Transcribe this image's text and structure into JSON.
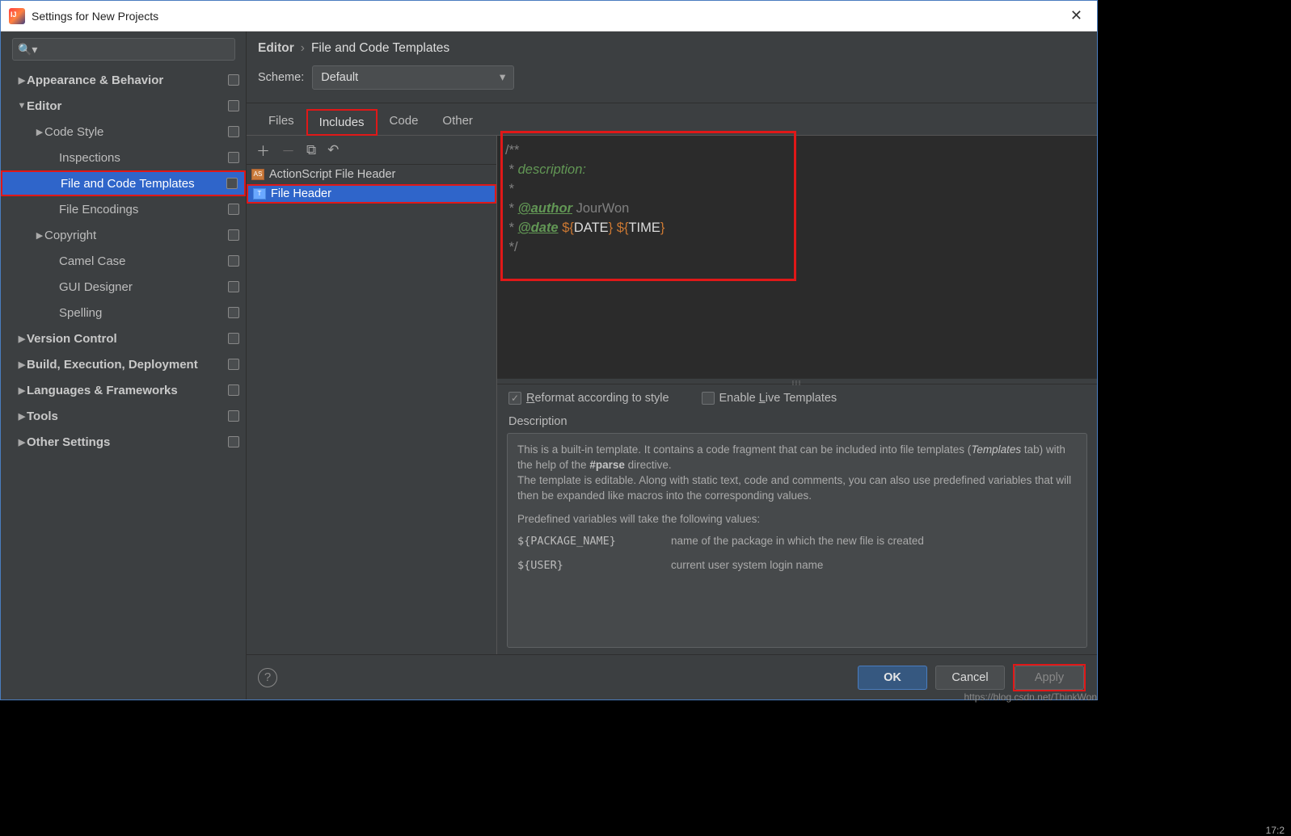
{
  "window": {
    "title": "Settings for New Projects"
  },
  "sidebar": {
    "items": [
      {
        "label": "Appearance & Behavior",
        "indent": 20,
        "chev": "▶",
        "bold": true
      },
      {
        "label": "Editor",
        "indent": 20,
        "chev": "▼",
        "bold": true
      },
      {
        "label": "Code Style",
        "indent": 42,
        "chev": "▶"
      },
      {
        "label": "Inspections",
        "indent": 60
      },
      {
        "label": "File and Code Templates",
        "indent": 60,
        "selected": true
      },
      {
        "label": "File Encodings",
        "indent": 60
      },
      {
        "label": "Copyright",
        "indent": 42,
        "chev": "▶"
      },
      {
        "label": "Camel Case",
        "indent": 60
      },
      {
        "label": "GUI Designer",
        "indent": 60
      },
      {
        "label": "Spelling",
        "indent": 60
      },
      {
        "label": "Version Control",
        "indent": 20,
        "chev": "▶",
        "bold": true
      },
      {
        "label": "Build, Execution, Deployment",
        "indent": 20,
        "chev": "▶",
        "bold": true
      },
      {
        "label": "Languages & Frameworks",
        "indent": 20,
        "chev": "▶",
        "bold": true
      },
      {
        "label": "Tools",
        "indent": 20,
        "chev": "▶",
        "bold": true
      },
      {
        "label": "Other Settings",
        "indent": 20,
        "chev": "▶",
        "bold": true
      }
    ]
  },
  "breadcrumb": {
    "root": "Editor",
    "current": "File and Code Templates"
  },
  "scheme": {
    "label": "Scheme:",
    "value": "Default"
  },
  "tabs": [
    "Files",
    "Includes",
    "Code",
    "Other"
  ],
  "template_list": [
    {
      "label": "ActionScript File Header",
      "icon": "AS"
    },
    {
      "label": "File Header",
      "icon": "T",
      "selected": true
    }
  ],
  "code": {
    "l1": "/**",
    "l2_star": " * ",
    "l2_text": "description:",
    "l3": " *",
    "l4_star": " * ",
    "l4_tag": "@author",
    "l4_val": " JourWon",
    "l5_star": " * ",
    "l5_tag": "@date",
    "l5_var1": " ${",
    "l5_var1b": "DATE",
    "l5_var1c": "} ${",
    "l5_var2b": "TIME",
    "l5_var2c": "}",
    "l6": " */"
  },
  "opts": {
    "reformat_pre": "R",
    "reformat": "eformat according to style",
    "live_pre": "Enable ",
    "live_u": "L",
    "live_post": "ive Templates"
  },
  "desc": {
    "label": "Description",
    "p1a": "This is a built-in template. It contains a code fragment that can be included into file templates (",
    "p1b": "Templates",
    "p1c": " tab) with the help of the ",
    "p1d": "#parse",
    "p1e": " directive.",
    "p2": "The template is editable. Along with static text, code and comments, you can also use predefined variables that will then be expanded like macros into the corresponding values.",
    "p3": "Predefined variables will take the following values:",
    "vars": [
      {
        "name": "${PACKAGE_NAME}",
        "desc": "name of the package in which the new file is created"
      },
      {
        "name": "${USER}",
        "desc": "current user system login name"
      }
    ]
  },
  "footer": {
    "ok": "OK",
    "cancel": "Cancel",
    "apply": "Apply"
  },
  "watermark": "https://blog.csdn.net/ThinkWon",
  "clock": "17:2"
}
